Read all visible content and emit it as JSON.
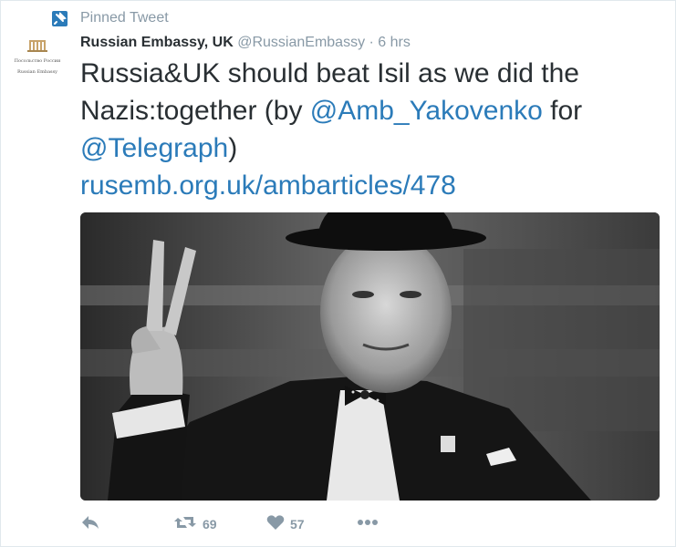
{
  "pinned": {
    "label": "Pinned Tweet",
    "icon": "pin-icon"
  },
  "author": {
    "name": "Russian Embassy, UK",
    "handle": "@RussianEmbassy",
    "separator": "·",
    "time": "6 hrs",
    "avatar_line1": "Посольство России",
    "avatar_line2": "Russian Embassy"
  },
  "tweet": {
    "text_part1": "Russia&UK should beat Isil as we did the Nazis:together (by ",
    "mention1": "@Amb_Yakovenko",
    "text_part2": " for ",
    "mention2": "@Telegraph",
    "text_part3": ")",
    "link": "rusemb.org.uk/ambarticles/478"
  },
  "actions": {
    "reply_icon": "reply-icon",
    "retweet_icon": "retweet-icon",
    "retweet_count": "69",
    "like_icon": "heart-icon",
    "like_count": "57",
    "more_icon": "more-icon"
  },
  "colors": {
    "accent": "#2b7bb9",
    "muted": "#8899a6",
    "text": "#292f33"
  }
}
